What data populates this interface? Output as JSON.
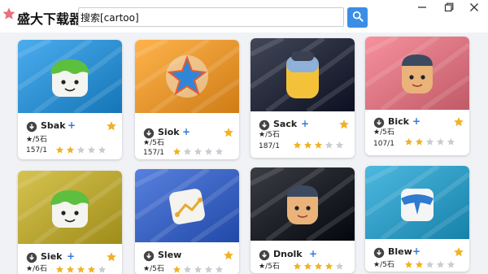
{
  "app": {
    "title": "盛大下载器",
    "search_value": "搜索[cartoo]"
  },
  "colors": {
    "accent": "#3a8ee6",
    "star_gold": "#f0b225",
    "star_grey": "#c9ccd1",
    "logo_pink": "#e9707c"
  },
  "icons": {
    "logo": "star-icon",
    "search": "search-icon",
    "minimize": "minimize-icon",
    "maximize": "maximize-icon",
    "close": "close-icon"
  },
  "cards": [
    {
      "name": "Sbak",
      "meta1": "★/5石",
      "meta2": "157/1",
      "rating": 2,
      "bg": "#2d8fd0",
      "char": "green-cube"
    },
    {
      "name": "Siok",
      "meta1": "★/5石",
      "meta2": "157/1",
      "rating": 1,
      "bg": "#e8952e",
      "char": "blue-star"
    },
    {
      "name": "Sack",
      "meta1": "★/5石",
      "meta2": "187/1",
      "rating": 3,
      "bg": "#24293a",
      "char": "yellow-jar"
    },
    {
      "name": "Bick",
      "meta1": "★/5石",
      "meta2": "107/1",
      "rating": 2,
      "bg": "#d9737f",
      "char": "orange-face"
    },
    {
      "name": "Siek",
      "meta1": "★/6石",
      "meta2": "",
      "rating": 4,
      "bg": "#b8a532",
      "char": "green-cube"
    },
    {
      "name": "Slew",
      "meta1": "★/5石",
      "meta2": "",
      "rating": 1,
      "bg": "#3a62c0",
      "char": "white-box"
    },
    {
      "name": "Dnolk",
      "meta1": "★/5石",
      "meta2": "",
      "rating": 4,
      "bg": "#1d1f26",
      "char": "orange-face"
    },
    {
      "name": "Blew",
      "meta1": "★/5石",
      "meta2": "",
      "rating": 2,
      "bg": "#2f9ac2",
      "char": "blue-box"
    }
  ]
}
